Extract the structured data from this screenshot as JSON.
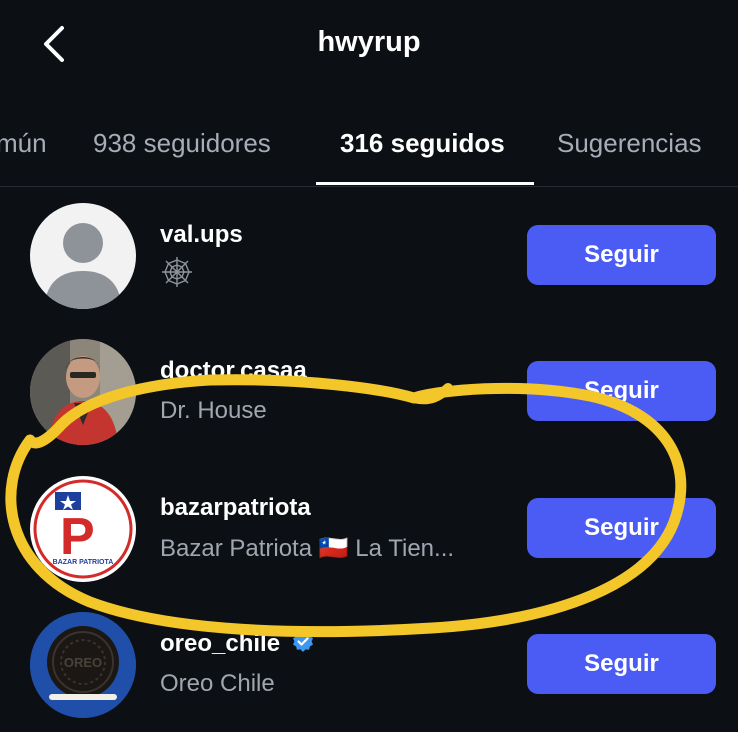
{
  "header": {
    "title": "hwyrup",
    "back_icon": "chevron-left-icon"
  },
  "tabs": [
    {
      "label": "mún",
      "active": false
    },
    {
      "label": "938 seguidores",
      "active": false
    },
    {
      "label": "316 seguidos",
      "active": true
    },
    {
      "label": "Sugerencias",
      "active": false
    }
  ],
  "accounts": [
    {
      "username": "val.ups",
      "subtitle": "",
      "subtitle_icon": "spiderweb-icon",
      "verified": false,
      "button": "Seguir"
    },
    {
      "username": "doctor.casaa",
      "subtitle": "Dr. House",
      "verified": false,
      "button": "Seguir"
    },
    {
      "username": "bazarpatriota",
      "subtitle": "Bazar Patriota 🇨🇱 La Tien...",
      "verified": false,
      "button": "Seguir",
      "avatar_text": "BAZAR PATRIOTA",
      "avatar_letter": "P"
    },
    {
      "username": "oreo_chile",
      "subtitle": "Oreo Chile",
      "verified": true,
      "button": "Seguir",
      "avatar_text": "OREO"
    }
  ],
  "colors": {
    "background": "#0c0f14",
    "button": "#4b5cf5",
    "annotation": "#f3c629",
    "verified": "#3b97f0"
  }
}
